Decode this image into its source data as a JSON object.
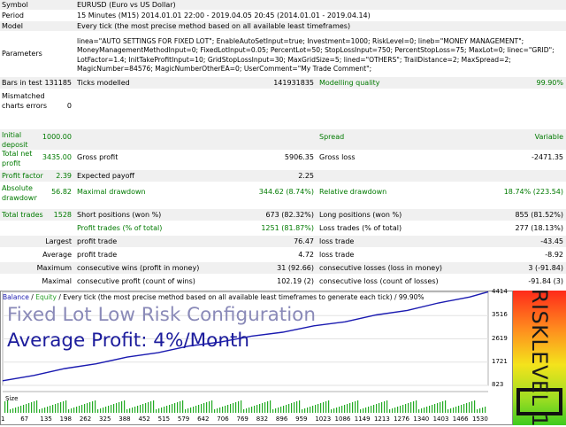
{
  "report": {
    "symbol_label": "Symbol",
    "symbol_value": "EURUSD (Euro vs US Dollar)",
    "period_label": "Period",
    "period_value": "15 Minutes (M15) 2014.01.01 22:00 - 2019.04.05 20:45 (2014.01.01 - 2019.04.14)",
    "model_label": "Model",
    "model_value": "Every tick (the most precise method based on all available least timeframes)",
    "parameters_label": "Parameters",
    "parameters_value": "linea=\"AUTO SETTINGS FOR FIXED LOT\"; EnableAutoSetInput=true; Investment=1000; RiskLevel=0; lineb=\"MONEY MANAGEMENT\"; MoneyManagementMethodInput=0; FixedLotInput=0.05; PercentLot=50; StopLossInput=750; PercentStopLoss=75; MaxLot=0; linec=\"GRID\"; LotFactor=1.4; InitTakeProfitInput=10; GridStopLossInput=30; MaxGridSize=5; lined=\"OTHERS\"; TrailDistance=2; MaxSpread=2; MagicNumber=84576; MagicNumberOtherEA=0; UserComment=\"My Trade Comment\";",
    "bars_label": "Bars in test",
    "bars_value": "131185",
    "ticks_label": "Ticks modelled",
    "ticks_value": "141931835",
    "quality_label": "Modelling quality",
    "quality_value": "99.90%",
    "mismatched_label": "Mismatched charts errors",
    "mismatched_value": "0",
    "deposit_label": "Initial deposit",
    "deposit_value": "1000.00",
    "spread_label": "Spread",
    "spread_value": "Variable",
    "netprofit_label": "Total net profit",
    "netprofit_value": "3435.00",
    "grossprofit_label": "Gross profit",
    "grossprofit_value": "5906.35",
    "grossloss_label": "Gross loss",
    "grossloss_value": "-2471.35",
    "pf_label": "Profit factor",
    "pf_value": "2.39",
    "payoff_label": "Expected payoff",
    "payoff_value": "2.25",
    "absdd_label": "Absolute drawdown",
    "absdd_value": "56.82",
    "maxdd_label": "Maximal drawdown",
    "maxdd_value": "344.62 (8.74%)",
    "reldd_label": "Relative drawdown",
    "reldd_value": "18.74% (223.54)",
    "trades_label": "Total trades",
    "trades_value": "1528",
    "short_label": "Short positions (won %)",
    "short_value": "673 (82.32%)",
    "long_label": "Long positions (won %)",
    "long_value": "855 (81.52%)",
    "profittrades_label": "Profit trades (% of total)",
    "profittrades_value": "1251 (81.87%)",
    "losstrades_label": "Loss trades (% of total)",
    "losstrades_value": "277 (18.13%)",
    "largest_label": "Largest",
    "largest_profit_label": "profit trade",
    "largest_profit_value": "76.47",
    "largest_loss_label": "loss trade",
    "largest_loss_value": "-43.45",
    "average_label": "Average",
    "average_profit_label": "profit trade",
    "average_profit_value": "4.72",
    "average_loss_label": "loss trade",
    "average_loss_value": "-8.92",
    "maximum_label": "Maximum",
    "maxwins_label": "consecutive wins (profit in money)",
    "maxwins_value": "31 (92.66)",
    "maxlosses_label": "consecutive losses (loss in money)",
    "maxlosses_value": "3 (-91.84)",
    "maximal_label": "Maximal",
    "maximalwins_label": "consecutive profit (count of wins)",
    "maximalwins_value": "102.19 (2)",
    "maximallosses_label": "consecutive loss (count of losses)",
    "maximallosses_value": "-91.84 (3)"
  },
  "chart": {
    "legend_balance": "Balance",
    "legend_sep": " / ",
    "legend_equity": "Equity",
    "legend_rest": " / Every tick (the most precise method based on all available least timeframes to generate each tick) / 99.90%",
    "overlay_line1": "Fixed Lot Low Risk Configuration",
    "overlay_line2": "Average Profit: 4%/Month",
    "size_label": "Size",
    "risk_text": "RISKLEVEL 1",
    "balance_color": "#1a1ab0",
    "volume_color": "#22aa22"
  },
  "chart_data": {
    "type": "line",
    "series": [
      {
        "name": "Balance",
        "x": [
          0,
          100,
          200,
          300,
          400,
          500,
          600,
          700,
          800,
          900,
          1000,
          1100,
          1200,
          1300,
          1400,
          1500,
          1560
        ],
        "values": [
          1000,
          1230,
          1450,
          1680,
          1890,
          2110,
          2320,
          2520,
          2700,
          2900,
          3100,
          3300,
          3520,
          3740,
          3980,
          4260,
          4435
        ]
      }
    ],
    "yticks": [
      "4414",
      "3516",
      "2619",
      "1721",
      "823"
    ],
    "xticks": [
      "1",
      "67",
      "135",
      "198",
      "262",
      "325",
      "388",
      "452",
      "515",
      "579",
      "642",
      "706",
      "769",
      "832",
      "896",
      "959",
      "1023",
      "1086",
      "1149",
      "1213",
      "1276",
      "1340",
      "1403",
      "1466",
      "1530"
    ],
    "ylim": [
      823,
      4450
    ],
    "xlim": [
      0,
      1560
    ]
  }
}
